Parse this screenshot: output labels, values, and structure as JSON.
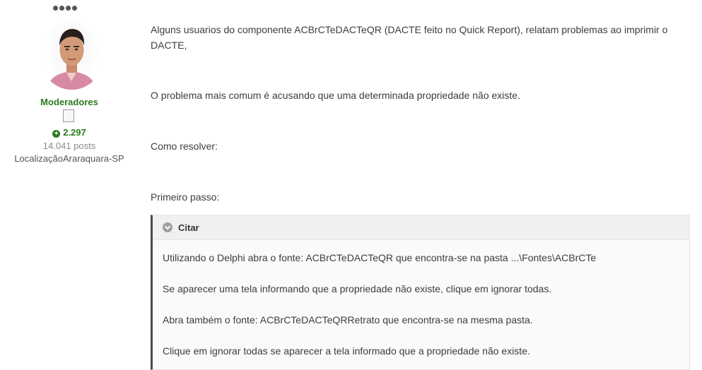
{
  "author": {
    "group": "Moderadores",
    "reputation": "2.297",
    "posts": "14.041 posts",
    "location": "LocalizaçãoAraraquara-SP"
  },
  "post": {
    "p1": "Alguns usuarios do componente ACBrCTeDACTeQR (DACTE feito no Quick Report), relatam problemas ao imprimir o DACTE,",
    "p2": "O problema mais comum é acusando que uma determinada propriedade não existe.",
    "p3": "Como resolver:",
    "p4": "Primeiro passo:"
  },
  "quote": {
    "title": "Citar",
    "lines": [
      " Utilizando o Delphi abra o fonte: ACBrCTeDACTeQR que encontra-se na pasta ...\\Fontes\\ACBrCTe",
      "Se aparecer uma tela informando que a propriedade não existe, clique em ignorar todas.",
      "Abra também o fonte: ACBrCTeDACTeQRRetrato que encontra-se na mesma pasta.",
      "Clique em ignorar todas se aparecer a tela informado que a propriedade não existe."
    ]
  },
  "colors": {
    "group": "#2b7a1e",
    "text": "#3d3d3d",
    "quote_border": "#4a4a4a"
  }
}
